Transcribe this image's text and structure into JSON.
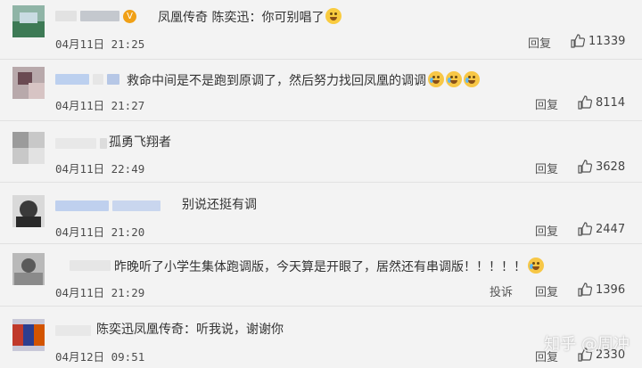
{
  "comments": [
    {
      "text": "凤凰传奇 陈奕迅：你可别唱了",
      "time": "04月11日 21:25",
      "reply": "回复",
      "likes": "11339",
      "emoji": "dog-face"
    },
    {
      "text": "救命中间是不是跑到原调了，然后努力找回凤凰的调调",
      "time": "04月11日 21:27",
      "reply": "回复",
      "likes": "8114",
      "emoji": "crying-laughing-face"
    },
    {
      "text": "孤勇飞翔者",
      "time": "04月11日 22:49",
      "reply": "回复",
      "likes": "3628"
    },
    {
      "text": "别说还挺有调",
      "time": "04月11日 21:20",
      "reply": "回复",
      "likes": "2447"
    },
    {
      "text": "昨晚听了小学生集体跑调版，今天算是开眼了，居然还有串调版！！！！！",
      "time": "04月11日 21:29",
      "report": "投诉",
      "reply": "回复",
      "likes": "1396",
      "emoji": "laughing-tears-face"
    },
    {
      "text": "陈奕迅凤凰传奇：听我说，谢谢你",
      "time": "04月12日 09:51",
      "reply": "回复",
      "likes": "2330"
    }
  ],
  "watermark": "知乎 @周冲",
  "colors": {
    "background": "#f3f3f3",
    "verified_badge": "#f0a016",
    "emoji": "#f9cb3f"
  }
}
